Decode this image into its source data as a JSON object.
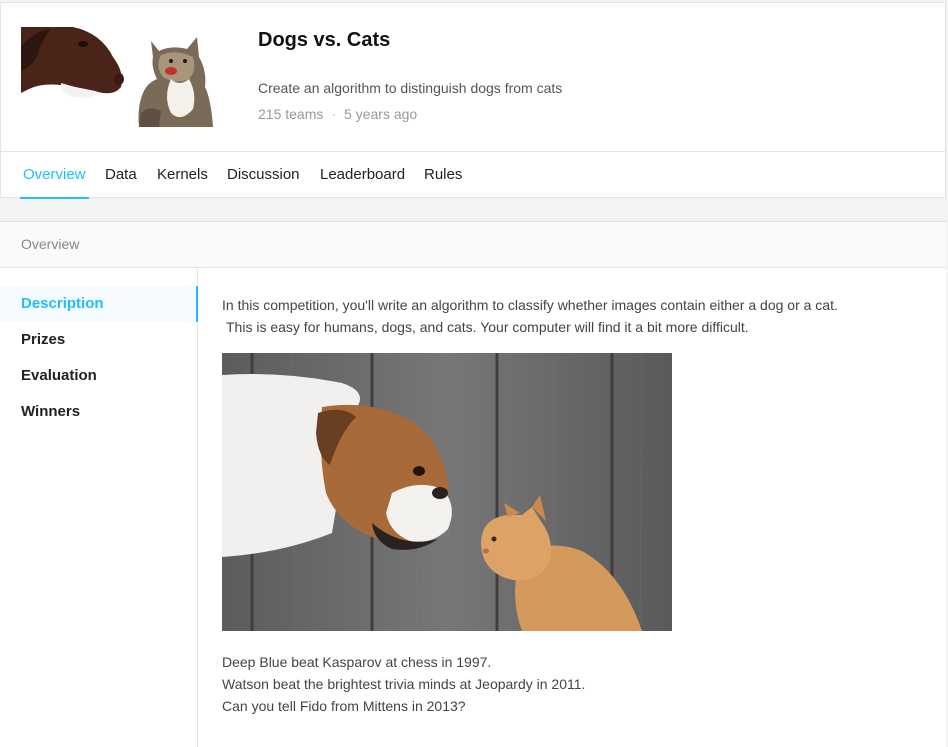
{
  "competition": {
    "title": "Dogs vs. Cats",
    "subtitle": "Create an algorithm to distinguish dogs from cats",
    "teams": "215 teams",
    "age": "5 years ago"
  },
  "tabs": [
    {
      "label": "Overview",
      "active": true
    },
    {
      "label": "Data"
    },
    {
      "label": "Kernels"
    },
    {
      "label": "Discussion"
    },
    {
      "label": "Leaderboard"
    },
    {
      "label": "Rules"
    }
  ],
  "panel": {
    "heading": "Overview",
    "sidebar": [
      {
        "label": "Description",
        "active": true
      },
      {
        "label": "Prizes"
      },
      {
        "label": "Evaluation"
      },
      {
        "label": "Winners"
      }
    ],
    "intro_line1": "In this competition, you'll write an algorithm to classify whether images contain either a dog or a cat.",
    "intro_line2": "This is easy for humans, dogs, and cats. Your computer will find it a bit more difficult.",
    "closing": [
      "Deep Blue beat Kasparov at chess in 1997.",
      "Watson beat the brightest trivia minds at Jeopardy in 2011.",
      "Can you tell Fido from Mittens in 2013?"
    ]
  },
  "colors": {
    "accent": "#20beff"
  }
}
